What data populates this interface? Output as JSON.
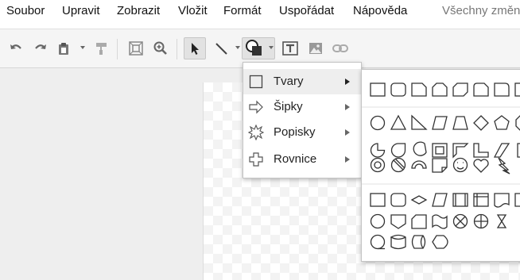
{
  "menubar": {
    "items": [
      "Soubor",
      "Upravit",
      "Zobrazit",
      "Vložit",
      "Formát",
      "Uspořádat",
      "Nápověda"
    ],
    "status": "Všechny změny"
  },
  "toolbar": {
    "buttons": [
      {
        "name": "undo-icon"
      },
      {
        "name": "redo-icon"
      },
      {
        "name": "paste-icon"
      },
      {
        "name": "paint-format-icon"
      },
      {
        "name": "fit-zoom-icon"
      },
      {
        "name": "zoom-icon"
      },
      {
        "name": "select-arrow-icon"
      },
      {
        "name": "line-icon"
      },
      {
        "name": "shape-icon"
      },
      {
        "name": "text-box-icon"
      },
      {
        "name": "image-icon"
      },
      {
        "name": "link-icon"
      }
    ]
  },
  "shape_menu": {
    "items": [
      {
        "label": "Tvary",
        "icon": "square-icon",
        "selected": true
      },
      {
        "label": "Šipky",
        "icon": "arrow-outline-icon",
        "selected": false
      },
      {
        "label": "Popisky",
        "icon": "starburst-icon",
        "selected": false
      },
      {
        "label": "Rovnice",
        "icon": "plus-outline-icon",
        "selected": false
      }
    ]
  },
  "shapes_submenu": {
    "groups": [
      {
        "name": "basic-shapes",
        "shapes": [
          "rectangle",
          "rounded-rectangle",
          "snip-corner-rectangle",
          "snip-same-side-rectangle",
          "snip-diagonal-rectangle",
          "round-snip-rectangle",
          "round-one-corner-rectangle"
        ]
      },
      {
        "name": "misc-shapes",
        "shapes": [
          "ellipse",
          "triangle",
          "right-triangle",
          "parallelogram",
          "trapezoid",
          "diamond",
          "pentagon",
          "pie",
          "teardrop",
          "chord",
          "frame",
          "half-frame",
          "corner",
          "diagonal-stripe",
          "donut",
          "no-symbol",
          "block-arc",
          "folded-corner",
          "smiley",
          "heart",
          "lightning-bolt"
        ]
      },
      {
        "name": "flowchart-shapes",
        "shapes": [
          "process",
          "alternate-process",
          "decision",
          "data",
          "predefined-process",
          "internal-storage",
          "document",
          "connector",
          "off-page-connector",
          "card",
          "punched-tape",
          "summing-junction",
          "or",
          "collate",
          "sequential-access-storage",
          "magnetic-disk",
          "direct-access-storage",
          "display"
        ]
      }
    ]
  }
}
